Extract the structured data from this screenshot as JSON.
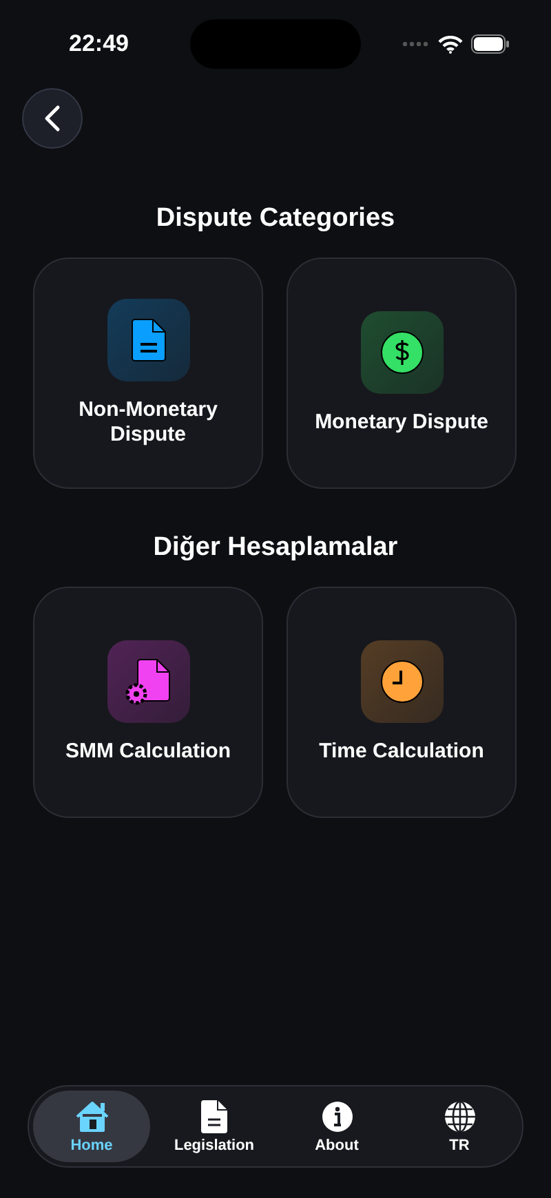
{
  "status_bar": {
    "time": "22:49"
  },
  "sections": [
    {
      "title": "Dispute Categories",
      "cards": [
        {
          "label": "Non-Monetary Dispute",
          "kind": "document",
          "color": "#0a9eff"
        },
        {
          "label": "Monetary Dispute",
          "kind": "dollar",
          "color": "#34e065"
        }
      ]
    },
    {
      "title": "Diğer Hesaplamalar",
      "cards": [
        {
          "label": "SMM Calculation",
          "kind": "doc-gear",
          "color": "#f042f0"
        },
        {
          "label": "Time Calculation",
          "kind": "clock",
          "color": "#ffa23a"
        }
      ]
    }
  ],
  "tab_bar": [
    {
      "label": "Home",
      "kind": "home",
      "selected": true
    },
    {
      "label": "Legislation",
      "kind": "document",
      "selected": false
    },
    {
      "label": "About",
      "kind": "info",
      "selected": false
    },
    {
      "label": "TR",
      "kind": "globe",
      "selected": false
    }
  ]
}
